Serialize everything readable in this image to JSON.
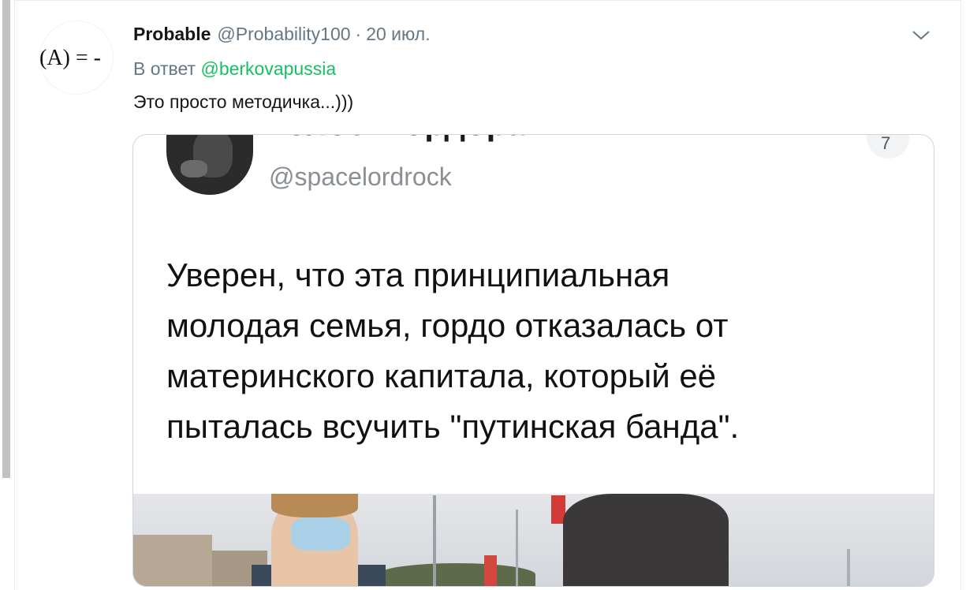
{
  "tweet": {
    "avatar_text": "(A) = -",
    "display_name": "Probable",
    "handle": "@Probability100",
    "separator": "·",
    "date": "20 июл.",
    "reply_prefix": "В ответ",
    "reply_to": "@berkovapussia",
    "text": "Это просто методичка...)))"
  },
  "quoted_image": {
    "author_name_cut": "Голос Мордора",
    "author_handle": "@spacelordrock",
    "badge_char": "7",
    "text": "Уверен, что эта принципиальная\nмолодая семья, гордо отказалась от\nматеринского капитала, который её\nпыталась всучить \"путинская банда\"."
  },
  "colors": {
    "link": "#17bf63",
    "secondary_text": "#657786",
    "primary_text": "#14171a",
    "border": "#ccd6dd"
  },
  "icons": {
    "menu": "chevron-down-icon"
  }
}
